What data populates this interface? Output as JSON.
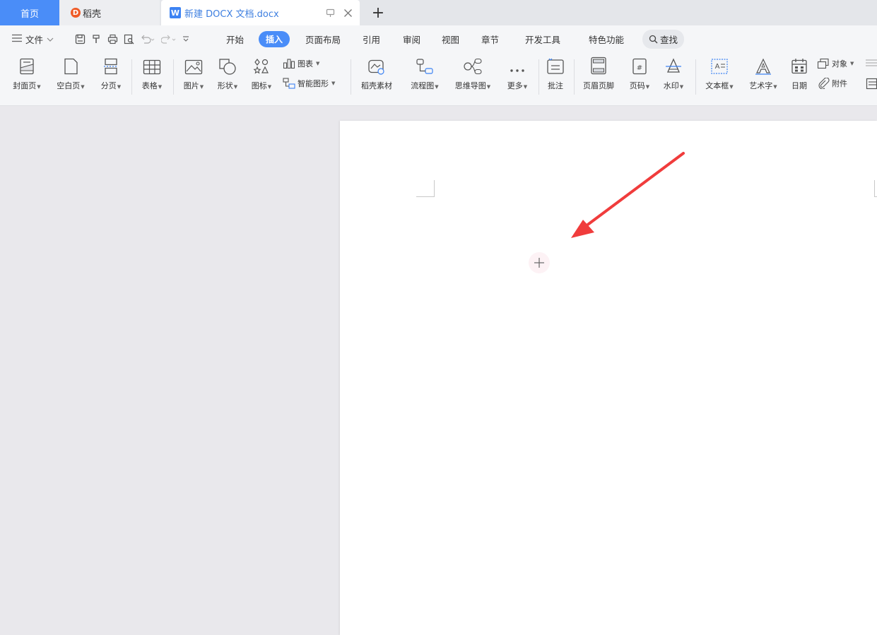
{
  "tabs": {
    "home": "首页",
    "daoke": "稻壳",
    "daoke_logo": "D",
    "doc_logo": "W",
    "document": "新建 DOCX 文档.docx",
    "new_tab": "+"
  },
  "menu": {
    "file": "文件",
    "tabs": [
      "开始",
      "插入",
      "页面布局",
      "引用",
      "审阅",
      "视图",
      "章节",
      "开发工具",
      "特色功能"
    ],
    "active_tab": "插入",
    "search": "查找"
  },
  "ribbon": {
    "cover_page": "封面页",
    "blank_page": "空白页",
    "page_break": "分页",
    "table": "表格",
    "picture": "图片",
    "shape": "形状",
    "icon": "图标",
    "chart": "图表",
    "smart_art": "智能图形",
    "daoke_material": "稻壳素材",
    "flowchart": "流程图",
    "mind_map": "思维导图",
    "more": "更多",
    "comment": "批注",
    "header_footer": "页眉页脚",
    "page_number": "页码",
    "watermark": "水印",
    "text_box": "文本框",
    "word_art": "艺术字",
    "date": "日期",
    "object": "对象",
    "attachment": "附件"
  },
  "colors": {
    "accent": "#4a8df8",
    "arrow": "#f03c3c",
    "doc_tab_text": "#3e7fe0"
  }
}
